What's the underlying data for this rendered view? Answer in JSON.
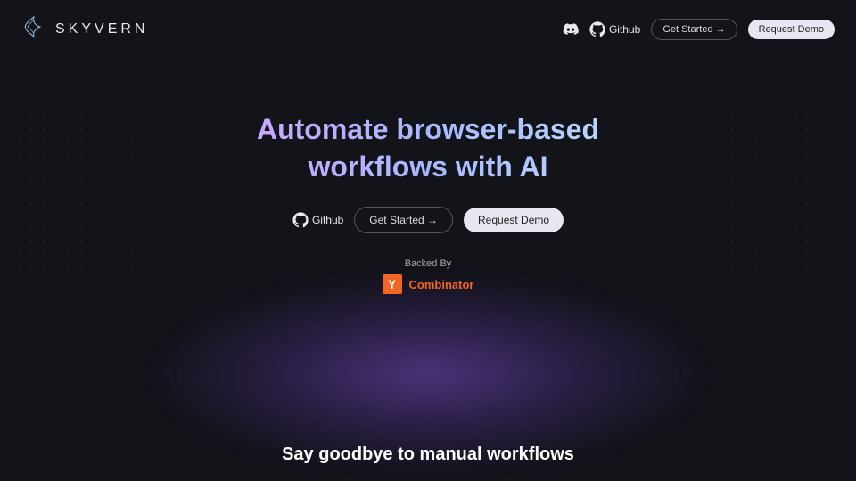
{
  "brand": {
    "name": "SKYVERN"
  },
  "nav": {
    "github_label": "Github",
    "get_started_label": "Get Started →",
    "request_demo_label": "Request Demo"
  },
  "hero": {
    "headline": "Automate browser-based workflows with AI",
    "github_label": "Github",
    "get_started_label": "Get Started →",
    "request_demo_label": "Request Demo"
  },
  "backed": {
    "label": "Backed By",
    "badge": "Y",
    "company": "Combinator"
  },
  "tagline": "Say goodbye to manual workflows"
}
